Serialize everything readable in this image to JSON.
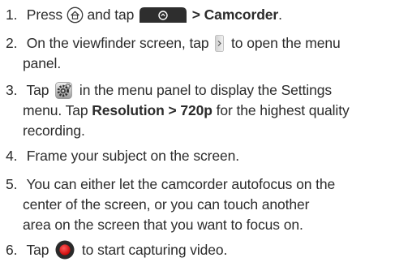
{
  "steps": [
    {
      "number": "1.",
      "segments": {
        "a": "Press",
        "b": "and tap",
        "c": "> Camcorder",
        "d": "."
      },
      "icons": [
        "home-icon",
        "camera-tab-icon"
      ]
    },
    {
      "number": "2.",
      "line1_a": "On the viewfinder screen, tap",
      "line1_b": "to open the menu",
      "line2": "panel.",
      "icons": [
        "menu-arrow-icon"
      ]
    },
    {
      "number": "3.",
      "line1_a": "Tap",
      "line1_b": "in the menu panel to display the Settings",
      "line2_a": "menu. Tap",
      "line2_bold": "Resolution > 720p",
      "line2_b": "for the highest quality",
      "line3": "recording.",
      "icons": [
        "settings-gear-icon"
      ]
    },
    {
      "number": "4.",
      "line1": "Frame your subject on the screen."
    },
    {
      "number": "5.",
      "line1": "You can either let the camcorder autofocus on the",
      "line2": "center of the screen, or you can touch another",
      "line3": "area on the screen that you want to focus on."
    },
    {
      "number": "6.",
      "line1_a": "Tap",
      "line1_b": "to start capturing video.",
      "icons": [
        "record-button-icon"
      ]
    }
  ],
  "colors": {
    "text": "#2b2b2b",
    "icon_dark": "#3a3a3a",
    "record_red": "#e3001b"
  }
}
